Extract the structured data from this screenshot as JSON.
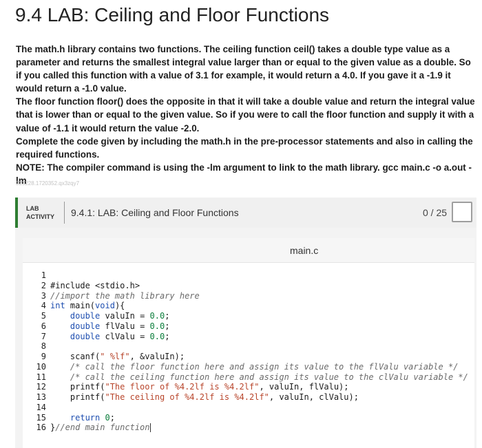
{
  "page": {
    "title": "9.4 LAB: Ceiling and Floor Functions",
    "paragraphs": [
      "The math.h library contains two functions. The ceiling function ceil() takes a double type value as a parameter and returns the smallest integral value larger than or equal to the given value as a double. So if you called this function with a value of 3.1 for example, it would return a 4.0. If you gave it a -1.9 it would return a -1.0 value.",
      "The floor function floor() does the opposite in that it will take a double value and return the integral value that is lower than or equal to the given value. So if you were to call the floor function and supply it with a value of -1.1 it would return the value -2.0.",
      "Complete the code given by including the math.h in the pre-processor statements and also in calling the required functions.",
      "NOTE: The compiler command is using the -lm argument to link to the math library. gcc main.c -o a.out -lm"
    ],
    "footer_id": "323228.1720352.qx3zqy7"
  },
  "lab": {
    "tag_line1": "LAB",
    "tag_line2": "ACTIVITY",
    "title": "9.4.1: LAB: Ceiling and Floor Functions",
    "score": "0 / 25"
  },
  "editor": {
    "filename": "main.c",
    "lines": [
      {
        "n": "1",
        "code": ""
      },
      {
        "n": "2",
        "code": "#include <stdio.h>"
      },
      {
        "n": "3",
        "code": "//import the math library here"
      },
      {
        "n": "4",
        "code": "int main(void){"
      },
      {
        "n": "5",
        "code": "    double valuIn = 0.0;"
      },
      {
        "n": "6",
        "code": "    double flValu = 0.0;"
      },
      {
        "n": "7",
        "code": "    double clValu = 0.0;"
      },
      {
        "n": "8",
        "code": ""
      },
      {
        "n": "9",
        "code": "    scanf(\" %lf\", &valuIn);"
      },
      {
        "n": "10",
        "code": "    /* call the floor function here and assign its value to the flValu variable */"
      },
      {
        "n": "11",
        "code": "    /* call the ceiling function here and assign its value to the clValu variable */"
      },
      {
        "n": "12",
        "code": "    printf(\"The floor of %4.2lf is %4.2lf\", valuIn, flValu);"
      },
      {
        "n": "13",
        "code": "    printf(\"The ceiling of %4.2lf is %4.2lf\", valuIn, clValu);"
      },
      {
        "n": "14",
        "code": ""
      },
      {
        "n": "15",
        "code": "    return 0;"
      },
      {
        "n": "16",
        "code": "}//end main function"
      }
    ]
  },
  "colors": {
    "accent_green": "#2e7d32",
    "comment": "#6a6a6a",
    "keyword": "#1f4fb0",
    "number": "#0a7d3a",
    "string": "#b8452b"
  }
}
